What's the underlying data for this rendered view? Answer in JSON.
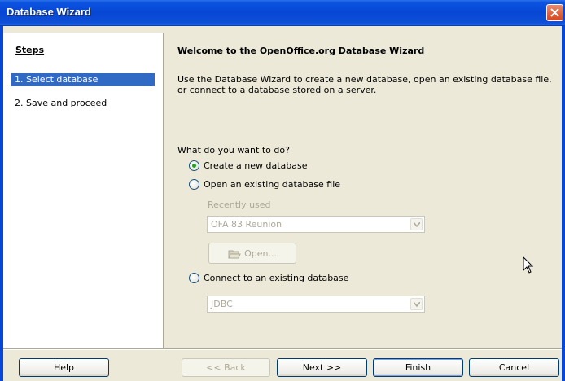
{
  "window": {
    "title": "Database Wizard"
  },
  "steps": {
    "heading": "Steps",
    "items": [
      {
        "label": "1. Select database",
        "active": true
      },
      {
        "label": "2. Save and proceed",
        "active": false
      }
    ]
  },
  "main": {
    "title": "Welcome to the OpenOffice.org Database Wizard",
    "intro": "Use the Database Wizard to create a new database, open an existing database file, or connect to a database stored on a server.",
    "question": "What do you want to do?",
    "option_create": "Create a new database",
    "option_open": "Open an existing database file",
    "recently_used_label": "Recently used",
    "recent_value": "OFA 83 Reunion",
    "open_button": "Open...",
    "option_connect": "Connect to an existing database",
    "connect_value": "JDBC",
    "selected_option": "create"
  },
  "buttons": {
    "help": "Help",
    "back": "<< Back",
    "next": "Next >>",
    "finish": "Finish",
    "cancel": "Cancel"
  },
  "colors": {
    "titlebar": "#0846d4",
    "selection": "#316ac5",
    "dialog_bg": "#ece9d8",
    "radio_check": "#21a121"
  }
}
